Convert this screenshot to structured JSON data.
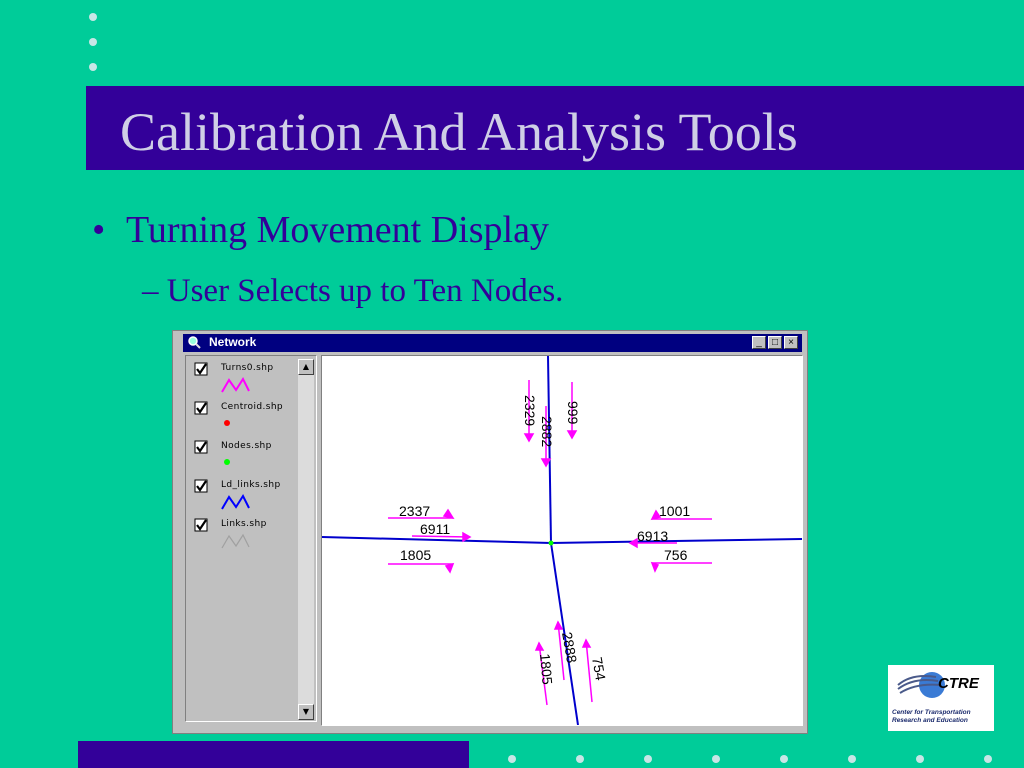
{
  "slide": {
    "title": "Calibration And Analysis Tools",
    "bullet_mark": "•",
    "bullet": "Turning Movement Display",
    "sub_bullet": "– User Selects up to Ten Nodes.",
    "colors": {
      "background": "#00cc99",
      "title_bar": "#330099",
      "title_text": "#cfcfe6",
      "body_text": "#330099"
    }
  },
  "window": {
    "title": "Network",
    "controls": {
      "minimize": "_",
      "maximize": "□",
      "close": "×"
    },
    "layers": [
      {
        "name": "Turns0.shp",
        "checked": true,
        "symbol": "magenta-zigzag-line",
        "color": "#ff00ff"
      },
      {
        "name": "Centroid.shp",
        "checked": true,
        "symbol": "red-dot",
        "color": "#ff0000"
      },
      {
        "name": "Nodes.shp",
        "checked": true,
        "symbol": "green-dot",
        "color": "#00ff00"
      },
      {
        "name": "Ld_links.shp",
        "checked": true,
        "symbol": "blue-zigzag-line",
        "color": "#0000ff"
      },
      {
        "name": "Links.shp",
        "checked": true,
        "symbol": "gray-zigzag-line",
        "color": "#a0a0a0"
      }
    ],
    "scroll": {
      "up": "▲",
      "down": "▼"
    }
  },
  "map": {
    "labels": {
      "north_left": "2329",
      "north_mid": "2882",
      "north_right": "999",
      "west_top": "2337",
      "west_mid": "6911",
      "west_bottom": "1805",
      "east_top": "1001",
      "east_mid": "6913",
      "east_bottom": "756",
      "south_left": "1805",
      "south_mid": "2888",
      "south_right": "754"
    },
    "colors": {
      "road": "#0000cc",
      "turn": "#ff00ff",
      "node": "#00ff00"
    }
  },
  "logo": {
    "word": "CTRE",
    "caption": "Center for Transportation Research and Education"
  }
}
